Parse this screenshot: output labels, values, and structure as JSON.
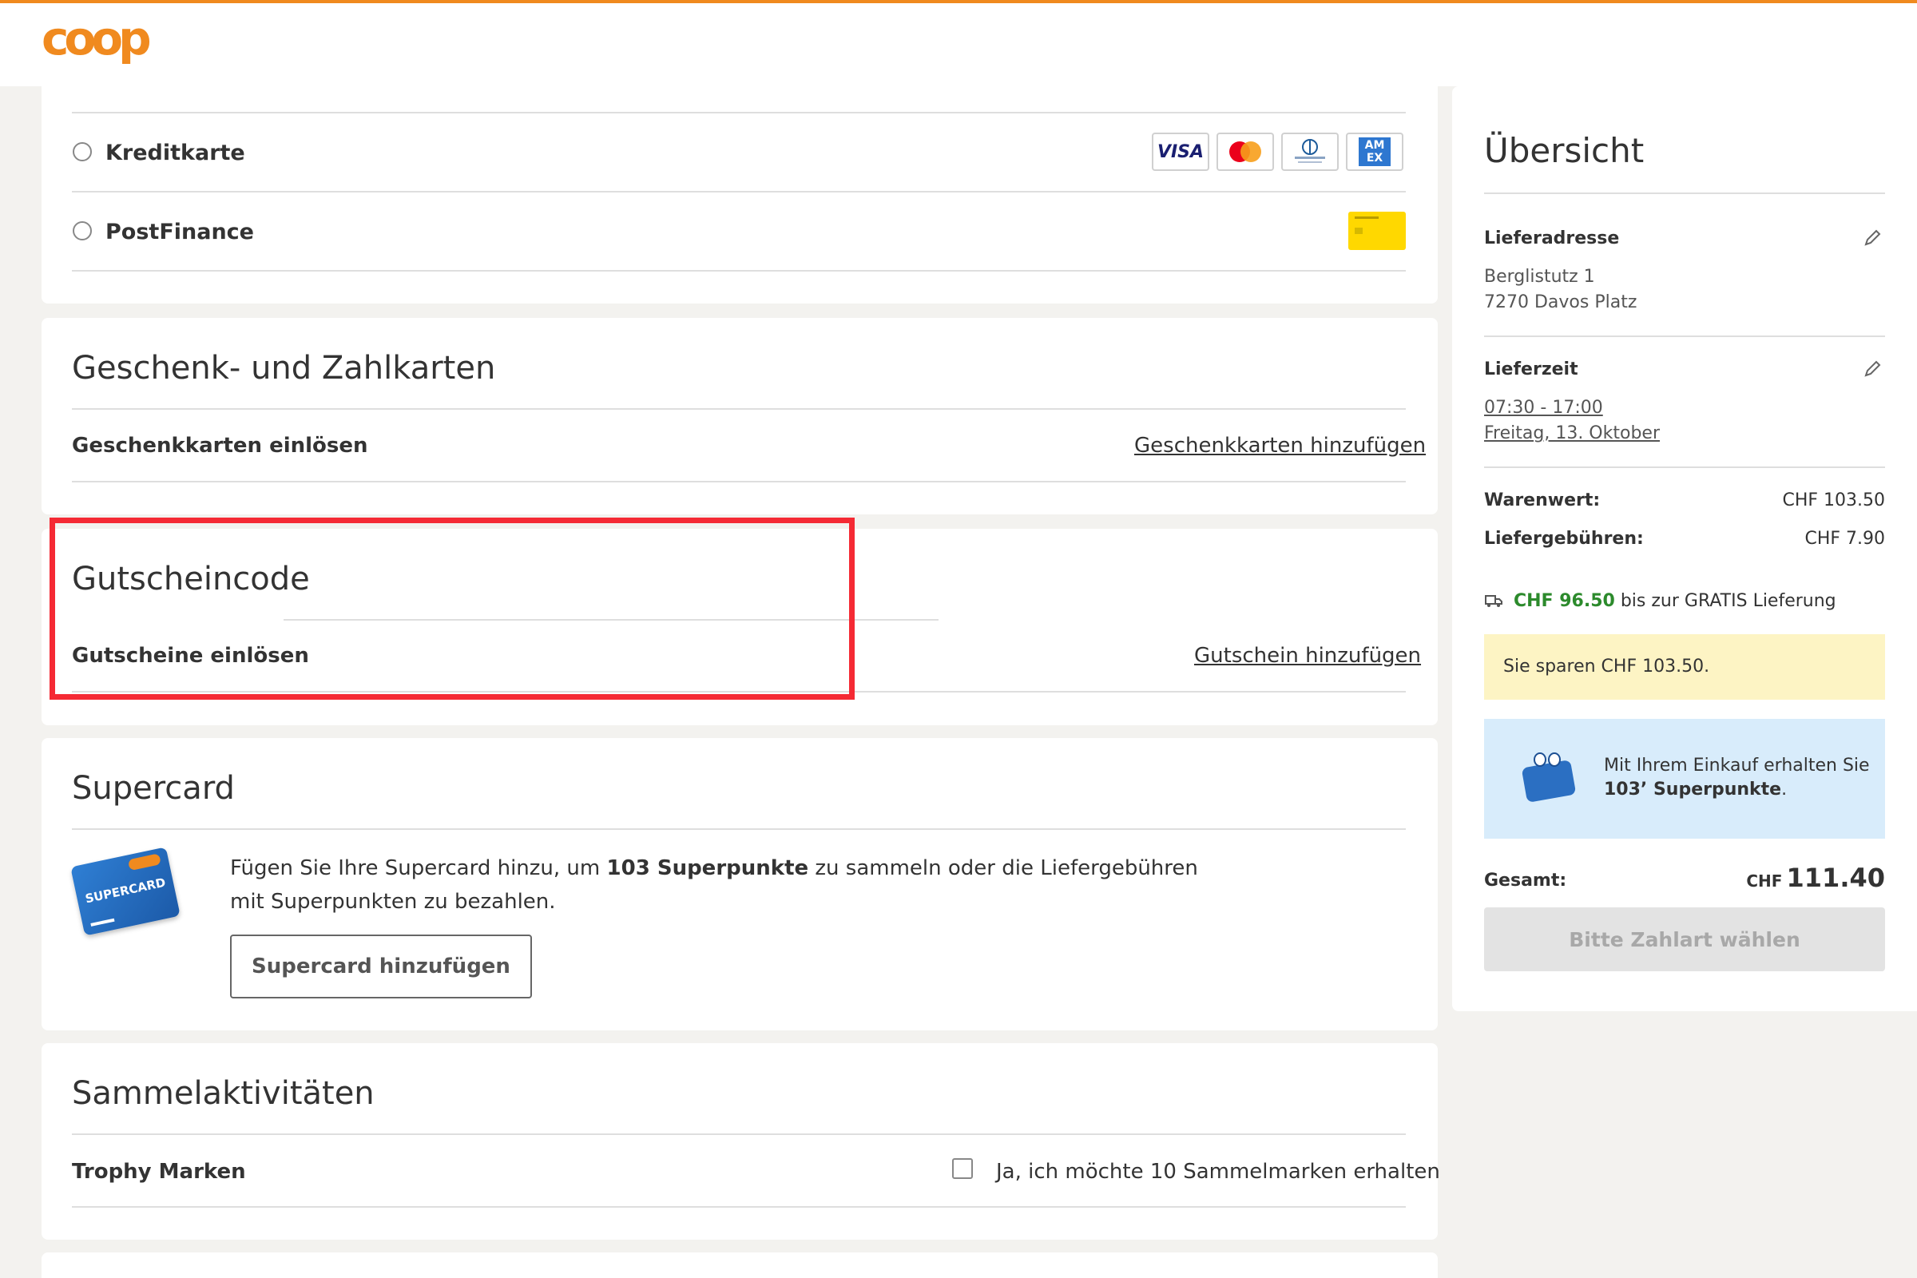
{
  "brand": {
    "logo_text": "coop",
    "accent": "#f08a1f"
  },
  "payment": {
    "options": [
      {
        "label": "Kreditkarte",
        "logos": [
          "VISA",
          "Mastercard",
          "Diners Club",
          "AMEX"
        ]
      },
      {
        "label": "PostFinance",
        "logos": [
          "PostFinance"
        ]
      }
    ],
    "card_logos": {
      "visa": "VISA",
      "amex": "AM EX"
    }
  },
  "gift_cards": {
    "title": "Geschenk- und Zahlkarten",
    "row_label": "Geschenkkarten einlösen",
    "link": "Geschenkkarten hinzufügen"
  },
  "voucher": {
    "title": "Gutscheincode",
    "row_label": "Gutscheine einlösen",
    "link": "Gutschein hinzufügen"
  },
  "supercard": {
    "title": "Supercard",
    "text_before": "Fügen Sie Ihre Supercard hinzu, um ",
    "text_bold": "103 Superpunkte",
    "text_after": " zu sammeln oder die Liefergebühren mit Superpunkten zu bezahlen.",
    "button": "Supercard hinzufügen",
    "card_label": "SUPERCARD"
  },
  "collect": {
    "title": "Sammelaktivitäten",
    "row_label": "Trophy Marken",
    "checkbox_label": "Ja, ich möchte 10 Sammelmarken erhalten"
  },
  "summary": {
    "title": "Übersicht",
    "address_label": "Lieferadresse",
    "address_line1": "Berglistutz 1",
    "address_line2": "7270 Davos Platz",
    "time_label": "Lieferzeit",
    "time_window": "07:30 - 17:00",
    "time_date": "Freitag, 13. Oktober",
    "goods_label": "Warenwert:",
    "goods_value": "CHF 103.50",
    "fee_label": "Liefergebühren:",
    "fee_value": "CHF 7.90",
    "free_amount": "CHF 96.50",
    "free_text": " bis zur GRATIS Lieferung",
    "savings": "Sie sparen CHF 103.50.",
    "points_line1": "Mit Ihrem Einkauf erhalten Sie",
    "points_bold": "103’ Superpunkte",
    "points_dot": ".",
    "total_label": "Gesamt:",
    "total_currency": "CHF",
    "total_value": "111.40",
    "cta": "Bitte Zahlart wählen"
  }
}
